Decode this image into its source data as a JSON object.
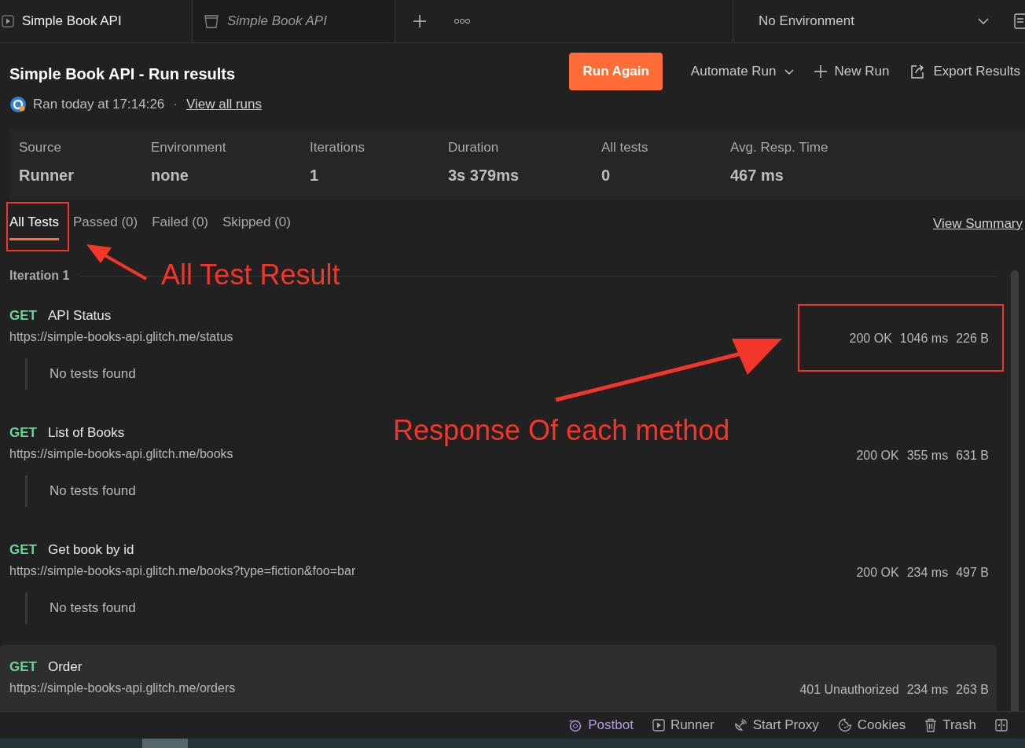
{
  "tabs": [
    {
      "kind": "runner",
      "label": "Simple Book API",
      "selected": true
    },
    {
      "kind": "collection",
      "label": "Simple Book API",
      "selected": false
    }
  ],
  "environment": {
    "label": "No Environment"
  },
  "header": {
    "title": "Simple Book API - Run results",
    "ran": "Ran today at 17:14:26",
    "separator": "·",
    "link": "View all runs",
    "actions": [
      {
        "kind": "primary",
        "label": "Run Again"
      },
      {
        "kind": "dropdown",
        "label": "Automate Run"
      },
      {
        "kind": "new",
        "label": "New Run"
      },
      {
        "kind": "export",
        "label": "Export Results"
      }
    ]
  },
  "summary": [
    {
      "label": "Source",
      "value": "Runner"
    },
    {
      "label": "Environment",
      "value": "none"
    },
    {
      "label": "Iterations",
      "value": "1"
    },
    {
      "label": "Duration",
      "value": "3s 379ms"
    },
    {
      "label": "All tests",
      "value": "0"
    },
    {
      "label": "Avg. Resp. Time",
      "value": "467 ms"
    }
  ],
  "result_tabs": [
    {
      "label": "All Tests",
      "selected": true
    },
    {
      "label": "Passed (0)",
      "selected": false
    },
    {
      "label": "Failed (0)",
      "selected": false
    },
    {
      "label": "Skipped (0)",
      "selected": false
    }
  ],
  "view_summary": "View Summary",
  "iteration": "Iteration 1",
  "requests": [
    {
      "method": "GET",
      "name": "API Status",
      "url": "https://simple-books-api.glitch.me/status",
      "status": "200 OK",
      "time": "1046 ms",
      "size": "226 B",
      "note": "No tests found",
      "hovered": false
    },
    {
      "method": "GET",
      "name": "List of Books",
      "url": "https://simple-books-api.glitch.me/books",
      "status": "200 OK",
      "time": "355 ms",
      "size": "631 B",
      "note": "No tests found",
      "hovered": false
    },
    {
      "method": "GET",
      "name": "Get book by id",
      "url": "https://simple-books-api.glitch.me/books?type=fiction&foo=bar",
      "status": "200 OK",
      "time": "234 ms",
      "size": "497 B",
      "note": "No tests found",
      "hovered": false
    },
    {
      "method": "GET",
      "name": "Order",
      "url": "https://simple-books-api.glitch.me/orders",
      "status": "401 Unauthorized",
      "time": "234 ms",
      "size": "263 B",
      "hovered": true
    }
  ],
  "status_bar": [
    {
      "kind": "postbot",
      "label": "Postbot"
    },
    {
      "kind": "runner",
      "label": "Runner"
    },
    {
      "kind": "proxy",
      "label": "Start Proxy"
    },
    {
      "kind": "cookies",
      "label": "Cookies"
    },
    {
      "kind": "trash",
      "label": "Trash"
    },
    {
      "kind": "layout"
    }
  ],
  "annotations": [
    {
      "text": "All Test Result"
    },
    {
      "text": "Response Of each method"
    }
  ]
}
